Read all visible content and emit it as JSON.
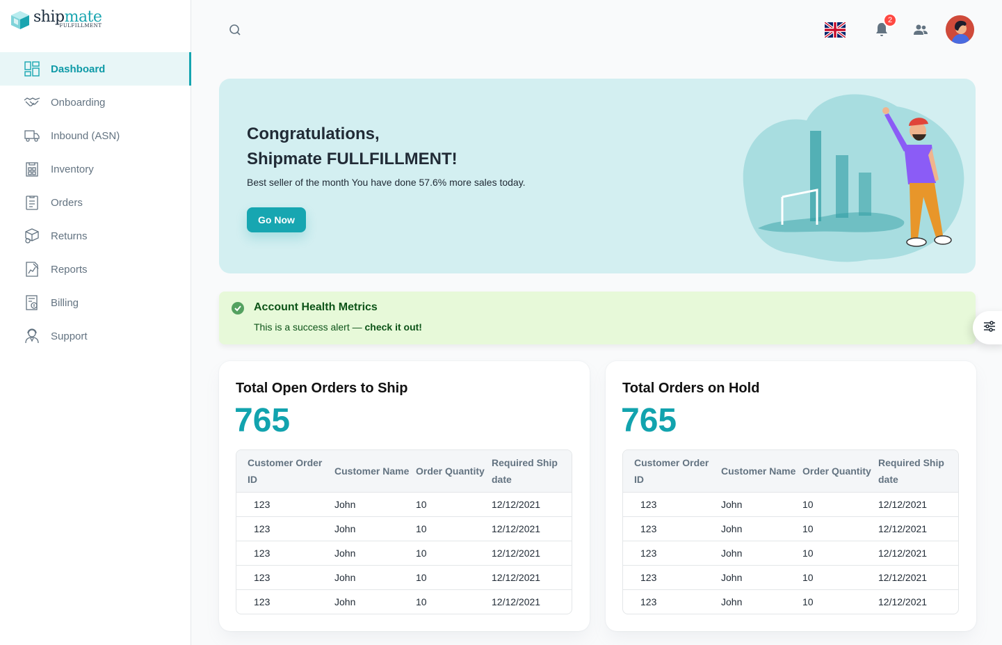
{
  "brand": {
    "name_part1": "ship",
    "name_part2": "mate",
    "tagline": "FULFILLMENT",
    "accent_color": "#16a5b0"
  },
  "sidebar": {
    "items": [
      {
        "label": "Dashboard",
        "icon": "dashboard-icon",
        "active": true
      },
      {
        "label": "Onboarding",
        "icon": "handshake-icon"
      },
      {
        "label": "Inbound (ASN)",
        "icon": "truck-icon"
      },
      {
        "label": "Inventory",
        "icon": "inventory-icon"
      },
      {
        "label": "Orders",
        "icon": "clipboard-icon"
      },
      {
        "label": "Returns",
        "icon": "returns-icon"
      },
      {
        "label": "Reports",
        "icon": "report-icon"
      },
      {
        "label": "Billing",
        "icon": "billing-icon"
      },
      {
        "label": "Support",
        "icon": "support-agent-icon"
      }
    ]
  },
  "header": {
    "notifications_count": "2",
    "language": "English (UK)"
  },
  "hero": {
    "title_line1": "Congratulations,",
    "title_line2": "Shipmate FULLFILLMENT!",
    "subtitle": "Best seller of the month You have done 57.6% more sales today.",
    "button_label": "Go Now"
  },
  "alert": {
    "title": "Account Health Metrics",
    "body_prefix": "This is a success alert — ",
    "body_link": "check it out!",
    "color": "#0c5317"
  },
  "cards": [
    {
      "title": "Total Open Orders to Ship",
      "value": "765",
      "columns": [
        "Customer Order ID",
        "Customer Name",
        "Order Quantity",
        "Required Ship date"
      ],
      "rows": [
        [
          "123",
          "John",
          "10",
          "12/12/2021"
        ],
        [
          "123",
          "John",
          "10",
          "12/12/2021"
        ],
        [
          "123",
          "John",
          "10",
          "12/12/2021"
        ],
        [
          "123",
          "John",
          "10",
          "12/12/2021"
        ],
        [
          "123",
          "John",
          "10",
          "12/12/2021"
        ]
      ]
    },
    {
      "title": "Total Orders on Hold",
      "value": "765",
      "columns": [
        "Customer Order ID",
        "Customer Name",
        "Order Quantity",
        "Required Ship date"
      ],
      "rows": [
        [
          "123",
          "John",
          "10",
          "12/12/2021"
        ],
        [
          "123",
          "John",
          "10",
          "12/12/2021"
        ],
        [
          "123",
          "John",
          "10",
          "12/12/2021"
        ],
        [
          "123",
          "John",
          "10",
          "12/12/2021"
        ],
        [
          "123",
          "John",
          "10",
          "12/12/2021"
        ]
      ]
    }
  ]
}
